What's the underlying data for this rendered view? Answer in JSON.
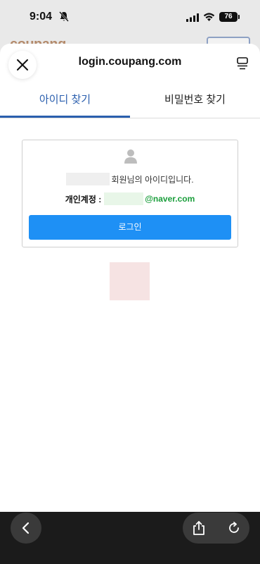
{
  "status_bar": {
    "time": "9:04",
    "battery": "76"
  },
  "background_page": {
    "logo_text": "coupang"
  },
  "sheet": {
    "url": "login.coupang.com"
  },
  "tabs": [
    {
      "label": "아이디 찾기",
      "active": true
    },
    {
      "label": "비밀번호 찾기",
      "active": false
    }
  ],
  "result": {
    "member_suffix": "회원님의 아이디입니다.",
    "account_label": "개인계정 :",
    "email_domain": "@naver.com",
    "login_button": "로그인"
  },
  "colors": {
    "accent": "#2b5fae",
    "button": "#1e90f5",
    "email": "#1a9e3b"
  }
}
